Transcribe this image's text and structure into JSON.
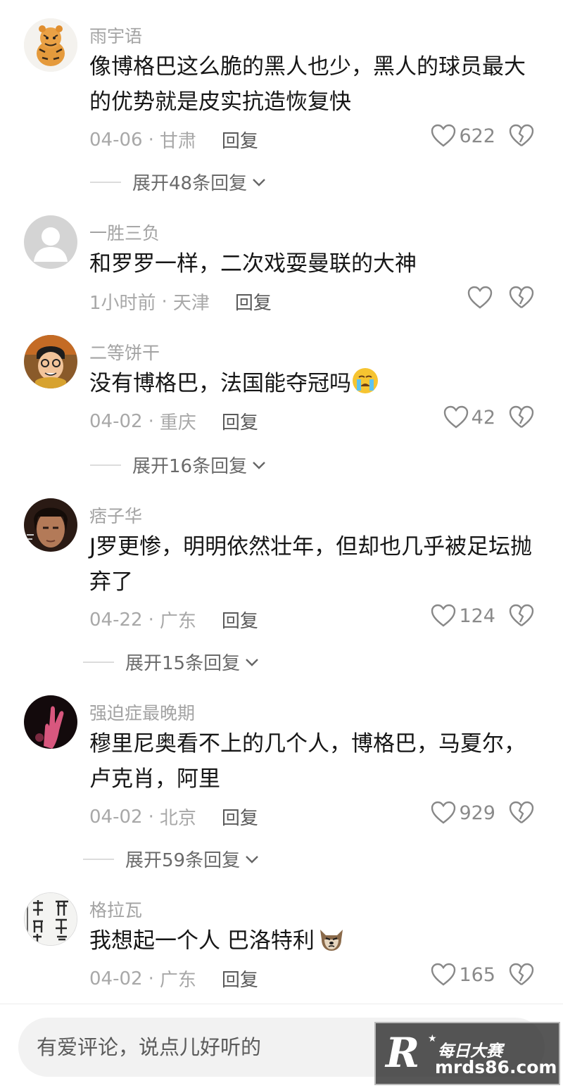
{
  "comments": [
    {
      "username": "雨宇语",
      "text": "像博格巴这么脆的黑人也少，黑人的球员最大的优势就是皮实抗造恢复快",
      "date": "04-06",
      "location": "甘肃",
      "reply_label": "回复",
      "likes": "622",
      "expand": "展开48条回复",
      "avatar": "tiger-avatar"
    },
    {
      "username": "一胜三负",
      "text": "和罗罗一样，二次戏耍曼联的大神",
      "date": "1小时前",
      "location": "天津",
      "reply_label": "回复",
      "likes": "",
      "avatar": "default-avatar"
    },
    {
      "username": "二等饼干",
      "text": "没有博格巴，法国能夺冠吗",
      "emoji": "crying-emoji",
      "date": "04-02",
      "location": "重庆",
      "reply_label": "回复",
      "likes": "42",
      "expand": "展开16条回复",
      "avatar": "cartoon-avatar"
    },
    {
      "username": "痞子华",
      "text": "J罗更惨，明明依然壮年，但却也几乎被足坛抛弃了",
      "date": "04-22",
      "location": "广东",
      "reply_label": "回复",
      "likes": "124",
      "expand": "展开15条回复",
      "avatar": "face-avatar"
    },
    {
      "username": "强迫症最晚期",
      "text": "穆里尼奥看不上的几个人，博格巴，马夏尔，卢克肖，阿里",
      "date": "04-02",
      "location": "北京",
      "reply_label": "回复",
      "likes": "929",
      "expand": "展开59条回复",
      "avatar": "hand-avatar"
    },
    {
      "username": "格拉瓦",
      "text": "我想起一个人 巴洛特利",
      "emoji": "dog-emoji",
      "date": "04-02",
      "location": "广东",
      "reply_label": "回复",
      "likes": "165",
      "avatar": "calligraphy-avatar"
    }
  ],
  "meta_separator": "·",
  "input": {
    "placeholder": "有爱评论，说点儿好听的"
  },
  "watermark": {
    "logo_letter": "R",
    "line1": "每日大赛",
    "line2": "mrds86.com"
  },
  "colors": {
    "username": "#a3a3a3",
    "text": "#161616",
    "meta": "#a8a8a8",
    "reply": "#5a5a5a",
    "input_bg": "#f2f2f2"
  }
}
